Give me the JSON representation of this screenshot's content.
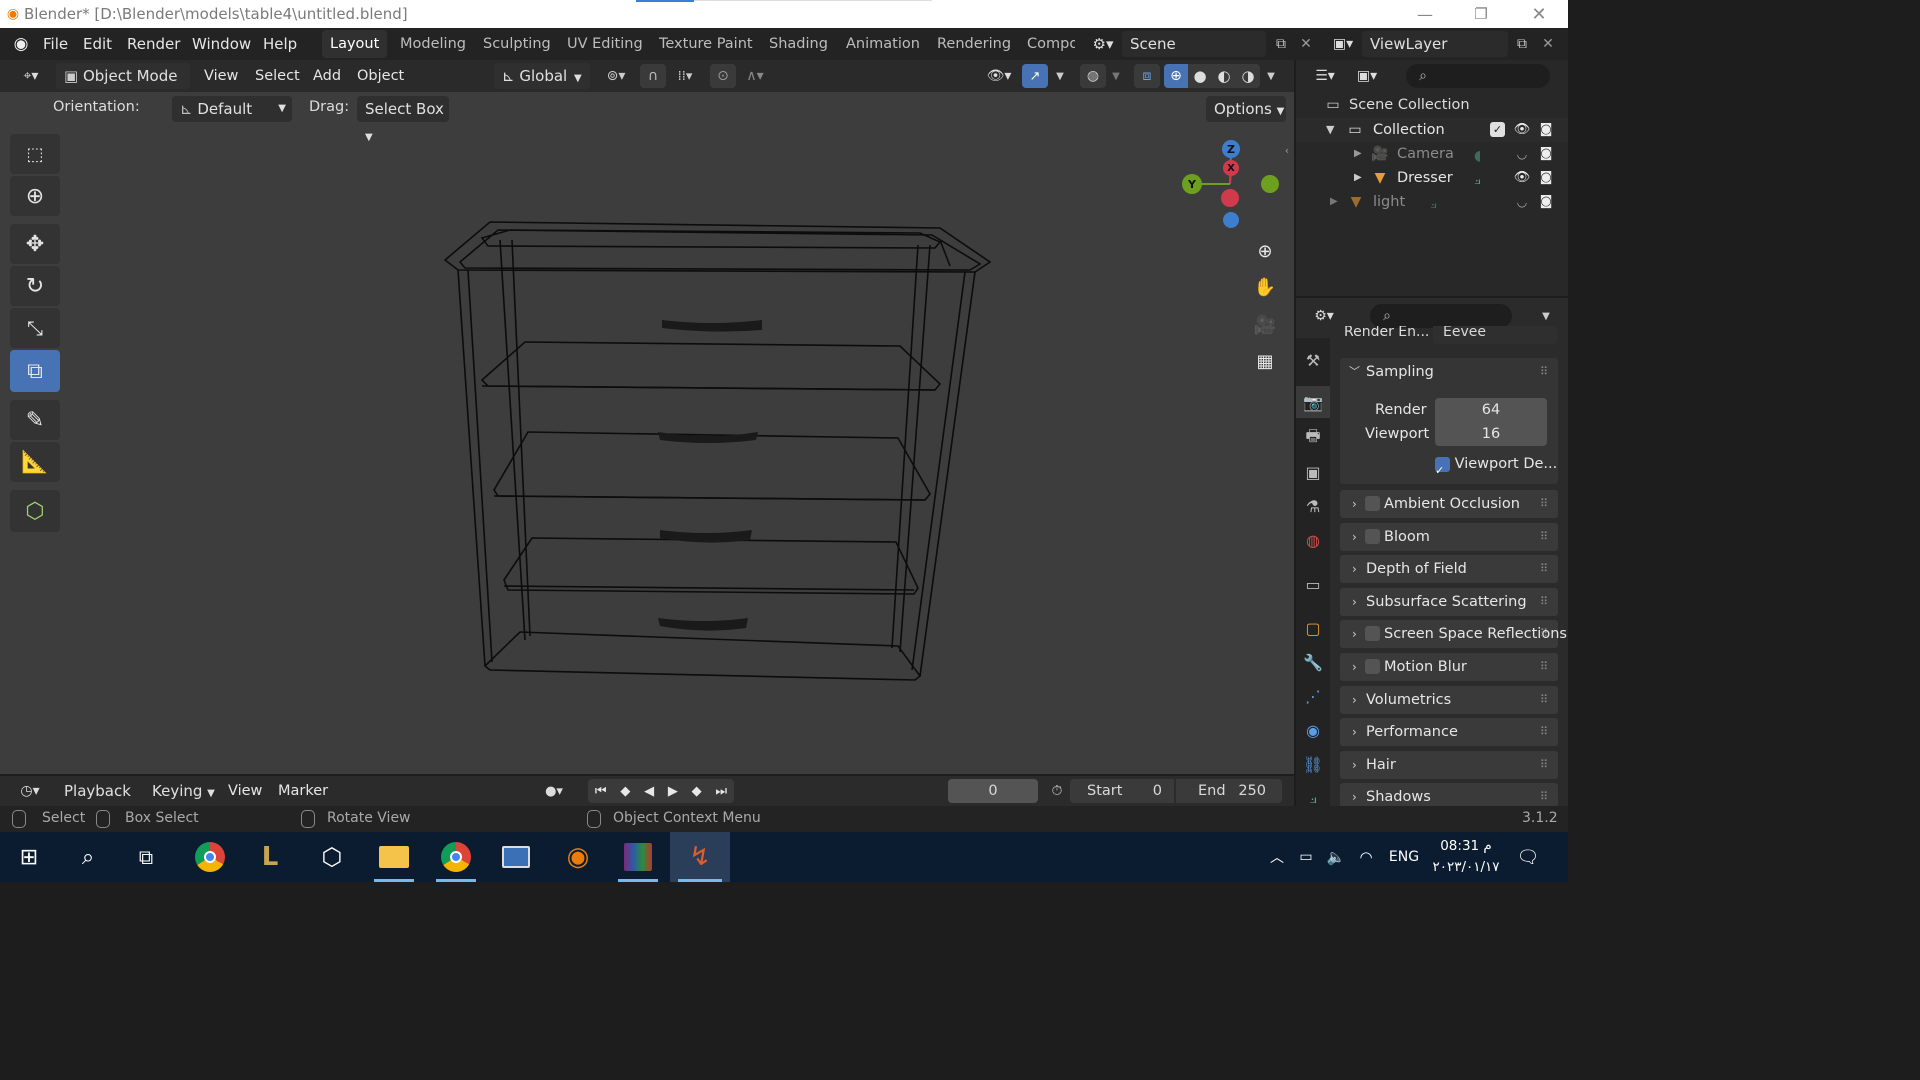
{
  "window": {
    "title": "Blender* [D:\\Blender\\models\\table4\\untitled.blend]"
  },
  "menu": {
    "items": [
      "File",
      "Edit",
      "Render",
      "Window",
      "Help"
    ]
  },
  "workspaces": {
    "tabs": [
      "Layout",
      "Modeling",
      "Sculpting",
      "UV Editing",
      "Texture Paint",
      "Shading",
      "Animation",
      "Rendering",
      "Compo"
    ],
    "active": "Layout"
  },
  "scene": {
    "name": "Scene",
    "view_layer": "ViewLayer"
  },
  "viewport_header": {
    "mode": "Object Mode",
    "menus": [
      "View",
      "Select",
      "Add",
      "Object"
    ],
    "transform_orientation": "Global"
  },
  "tool_settings": {
    "orientation_label": "Orientation:",
    "orientation_value": "Default",
    "drag_label": "Drag:",
    "drag_value": "Select Box",
    "options_label": "Options"
  },
  "gizmo": {
    "z": "Z",
    "x": "X",
    "y": "Y"
  },
  "outliner": {
    "root": "Scene Collection",
    "collection": "Collection",
    "items": [
      {
        "name": "Camera",
        "icon": "camera-icon",
        "dim": true
      },
      {
        "name": "Dresser",
        "icon": "mesh-icon",
        "dim": false
      },
      {
        "name": "light",
        "icon": "mesh-icon",
        "dim": true
      }
    ]
  },
  "properties": {
    "render_engine_label": "Render En...",
    "render_engine_value": "Eevee",
    "sampling": {
      "title": "Sampling",
      "render_label": "Render",
      "render_value": "64",
      "viewport_label": "Viewport",
      "viewport_value": "16",
      "denoise_label": "Viewport De..."
    },
    "panels": [
      {
        "title": "Ambient Occlusion",
        "checkbox": true
      },
      {
        "title": "Bloom",
        "checkbox": true
      },
      {
        "title": "Depth of Field",
        "checkbox": false
      },
      {
        "title": "Subsurface Scattering",
        "checkbox": false
      },
      {
        "title": "Screen Space Reflections",
        "checkbox": true
      },
      {
        "title": "Motion Blur",
        "checkbox": true
      },
      {
        "title": "Volumetrics",
        "checkbox": false
      },
      {
        "title": "Performance",
        "checkbox": false
      },
      {
        "title": "Hair",
        "checkbox": false
      },
      {
        "title": "Shadows",
        "checkbox": false
      }
    ]
  },
  "timeline": {
    "menus": [
      "Playback",
      "Keying",
      "View",
      "Marker"
    ],
    "current_frame": "0",
    "start_label": "Start",
    "start_value": "0",
    "end_label": "End",
    "end_value": "250"
  },
  "statusbar": {
    "select": "Select",
    "box_select": "Box Select",
    "rotate_view": "Rotate View",
    "context_menu": "Object Context Menu",
    "version": "3.1.2"
  },
  "taskbar": {
    "lang": "ENG",
    "time": "08:31 م",
    "date": "٢٠٢٣/٠١/١٧"
  },
  "colors": {
    "accent": "#4772b3",
    "axis_x": "#d03a4b",
    "axis_y": "#6ea01f",
    "axis_z": "#3d7fce"
  }
}
